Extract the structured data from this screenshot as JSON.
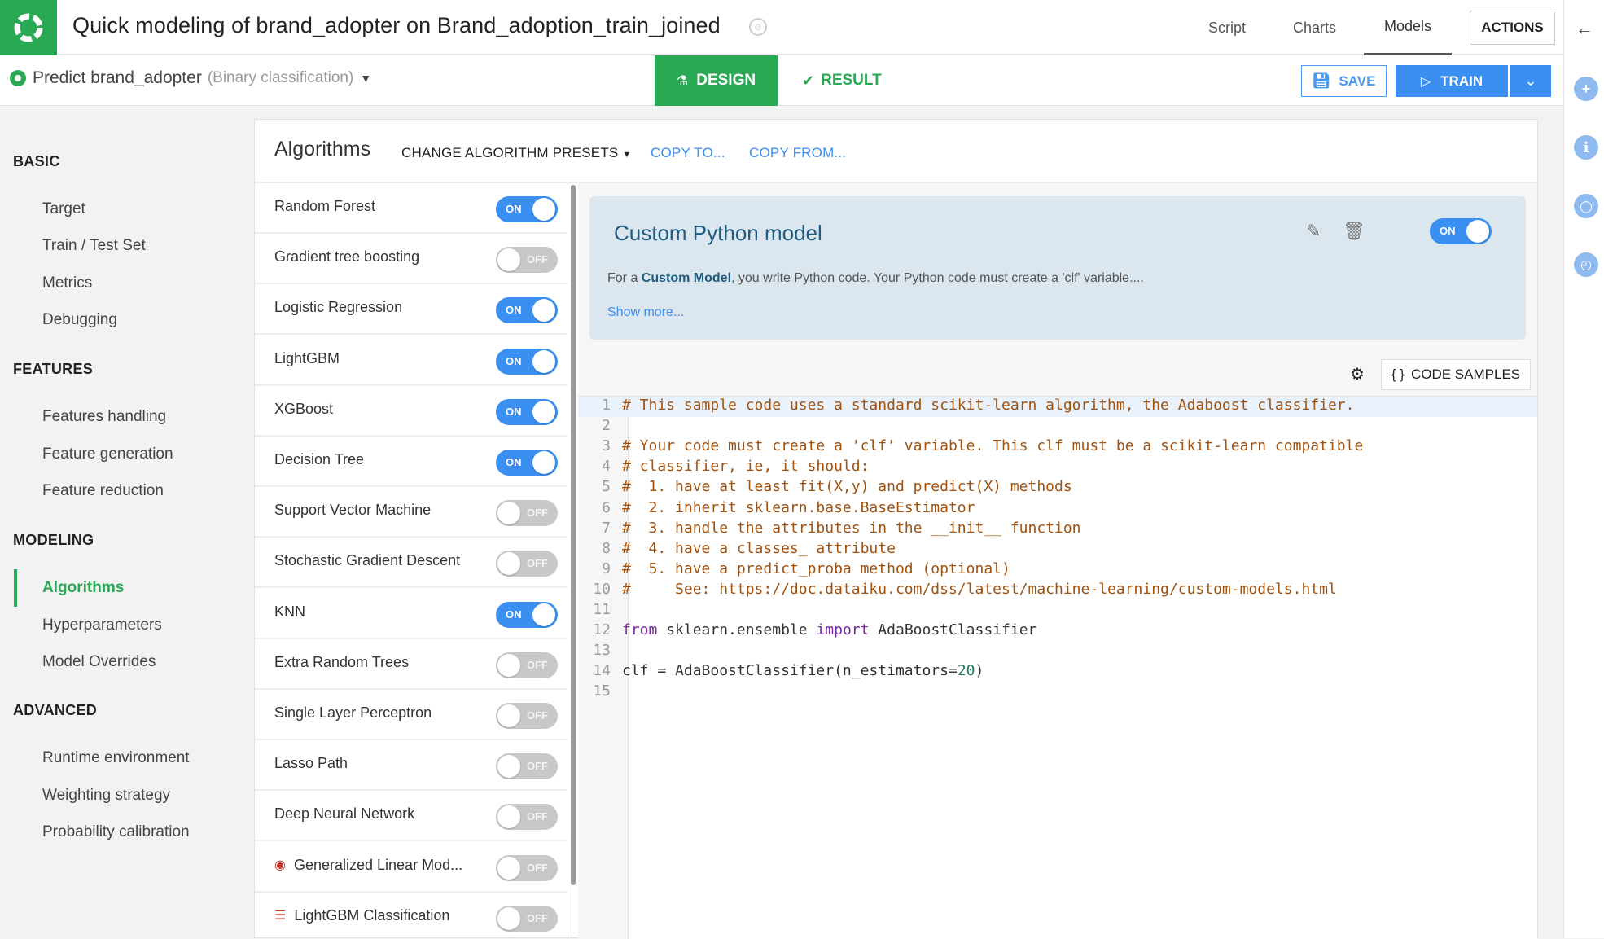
{
  "header": {
    "title": "Quick modeling of brand_adopter on Brand_adoption_train_joined",
    "nav": [
      {
        "label": "Script",
        "active": false
      },
      {
        "label": "Charts",
        "active": false
      },
      {
        "label": "Models",
        "active": true
      }
    ],
    "actions_label": "ACTIONS"
  },
  "subbar": {
    "predict_label": "Predict brand_adopter",
    "predict_type": "(Binary classification)",
    "design_label": "DESIGN",
    "result_label": "RESULT",
    "save_label": "SAVE",
    "train_label": "TRAIN"
  },
  "right_rail": {
    "icons": [
      "back-arrow-icon",
      "plus-icon",
      "info-icon",
      "discussion-icon",
      "history-icon"
    ]
  },
  "sidebar": {
    "sections": [
      {
        "title": "BASIC",
        "items": [
          "Target",
          "Train / Test Set",
          "Metrics",
          "Debugging"
        ]
      },
      {
        "title": "FEATURES",
        "items": [
          "Features handling",
          "Feature generation",
          "Feature reduction"
        ]
      },
      {
        "title": "MODELING",
        "items": [
          "Algorithms",
          "Hyperparameters",
          "Model Overrides"
        ]
      },
      {
        "title": "ADVANCED",
        "items": [
          "Runtime environment",
          "Weighting strategy",
          "Probability calibration"
        ]
      }
    ],
    "active_item": "Algorithms"
  },
  "panel": {
    "title": "Algorithms",
    "preset_label": "CHANGE ALGORITHM PRESETS",
    "copy_to_label": "COPY TO...",
    "copy_from_label": "COPY FROM...",
    "algorithms": [
      {
        "name": "Random Forest",
        "on": true,
        "icon": ""
      },
      {
        "name": "Gradient tree boosting",
        "on": false,
        "icon": ""
      },
      {
        "name": "Logistic Regression",
        "on": true,
        "icon": ""
      },
      {
        "name": "LightGBM",
        "on": true,
        "icon": ""
      },
      {
        "name": "XGBoost",
        "on": true,
        "icon": ""
      },
      {
        "name": "Decision Tree",
        "on": true,
        "icon": ""
      },
      {
        "name": "Support Vector Machine",
        "on": false,
        "icon": ""
      },
      {
        "name": "Stochastic Gradient Descent",
        "on": false,
        "icon": ""
      },
      {
        "name": "KNN",
        "on": true,
        "icon": ""
      },
      {
        "name": "Extra Random Trees",
        "on": false,
        "icon": ""
      },
      {
        "name": "Single Layer Perceptron",
        "on": false,
        "icon": ""
      },
      {
        "name": "Lasso Path",
        "on": false,
        "icon": ""
      },
      {
        "name": "Deep Neural Network",
        "on": false,
        "icon": ""
      },
      {
        "name": "Generalized Linear Mod...",
        "on": false,
        "icon": "target-icon"
      },
      {
        "name": "LightGBM Classification",
        "on": false,
        "icon": "list-icon"
      }
    ],
    "toggle_on_label": "ON",
    "toggle_off_label": "OFF"
  },
  "custom_model": {
    "title": "Custom Python model",
    "desc_prefix": "For a ",
    "desc_bold": "Custom Model",
    "desc_suffix": ", you write Python code. Your Python code must create a 'clf' variable....",
    "show_more": "Show more...",
    "enabled": true,
    "code_samples_label": "CODE SAMPLES",
    "code_lines": [
      {
        "n": "1",
        "type": "comment",
        "text": "# This sample code uses a standard scikit-learn algorithm, the Adaboost classifier."
      },
      {
        "n": "2",
        "type": "blank",
        "text": ""
      },
      {
        "n": "3",
        "type": "comment",
        "text": "# Your code must create a 'clf' variable. This clf must be a scikit-learn compatible"
      },
      {
        "n": "4",
        "type": "comment",
        "text": "# classifier, ie, it should:"
      },
      {
        "n": "5",
        "type": "comment",
        "text": "#  1. have at least fit(X,y) and predict(X) methods"
      },
      {
        "n": "6",
        "type": "comment",
        "text": "#  2. inherit sklearn.base.BaseEstimator"
      },
      {
        "n": "7",
        "type": "comment",
        "text": "#  3. handle the attributes in the __init__ function"
      },
      {
        "n": "8",
        "type": "comment",
        "text": "#  4. have a classes_ attribute"
      },
      {
        "n": "9",
        "type": "comment",
        "text": "#  5. have a predict_proba method (optional)"
      },
      {
        "n": "10",
        "type": "comment",
        "text": "#     See: https://doc.dataiku.com/dss/latest/machine-learning/custom-models.html"
      },
      {
        "n": "11",
        "type": "blank",
        "text": ""
      },
      {
        "n": "12",
        "type": "import",
        "text": "from sklearn.ensemble import AdaBoostClassifier"
      },
      {
        "n": "13",
        "type": "blank",
        "text": ""
      },
      {
        "n": "14",
        "type": "assign",
        "text": "clf = AdaBoostClassifier(n_estimators=20)"
      },
      {
        "n": "15",
        "type": "blank",
        "text": ""
      }
    ]
  },
  "colors": {
    "brand_green": "#2aa955",
    "accent_blue": "#3b8ff0",
    "card_bg": "#dbe6ee",
    "comment": "#a0520f",
    "keyword": "#7a2a9c"
  }
}
